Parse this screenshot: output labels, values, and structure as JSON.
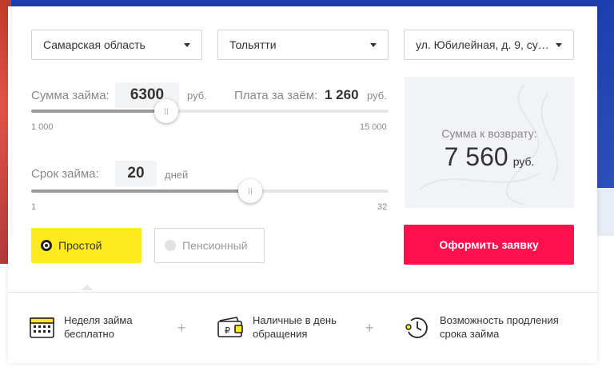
{
  "region_select": {
    "value": "Самарская область"
  },
  "city_select": {
    "value": "Тольятти"
  },
  "office_select": {
    "value": "ул. Юбилейная, д. 9, суп..."
  },
  "loan_amount": {
    "label": "Сумма займа:",
    "value": "6300",
    "unit": "руб.",
    "min_label": "1 000",
    "max_label": "15 000",
    "min": 1000,
    "max": 15000,
    "current": 6300
  },
  "loan_fee": {
    "label": "Плата за заём:",
    "value": "1 260",
    "unit": "руб."
  },
  "loan_term": {
    "label": "Срок займа:",
    "value": "20",
    "unit": "дней",
    "min_label": "1",
    "max_label": "32",
    "min": 1,
    "max": 32,
    "current": 20
  },
  "loan_type": {
    "options": [
      {
        "label": "Простой",
        "selected": true
      },
      {
        "label": "Пенсионный",
        "selected": false
      }
    ]
  },
  "total": {
    "label": "Сумма к возврату:",
    "value": "7 560",
    "unit": "руб."
  },
  "submit_button": {
    "label": "Оформить заявку"
  },
  "features": [
    {
      "icon": "calendar-icon",
      "text_line1": "Неделя займа",
      "text_line2": "бесплатно"
    },
    {
      "icon": "wallet-icon",
      "text_line1": "Наличные в день",
      "text_line2": "обращения"
    },
    {
      "icon": "clock-extend-icon",
      "text_line1": "Возможность продления",
      "text_line2": "срока займа"
    }
  ],
  "colors": {
    "accent_yellow": "#ffe91f",
    "submit_red": "#ff0f4b"
  }
}
